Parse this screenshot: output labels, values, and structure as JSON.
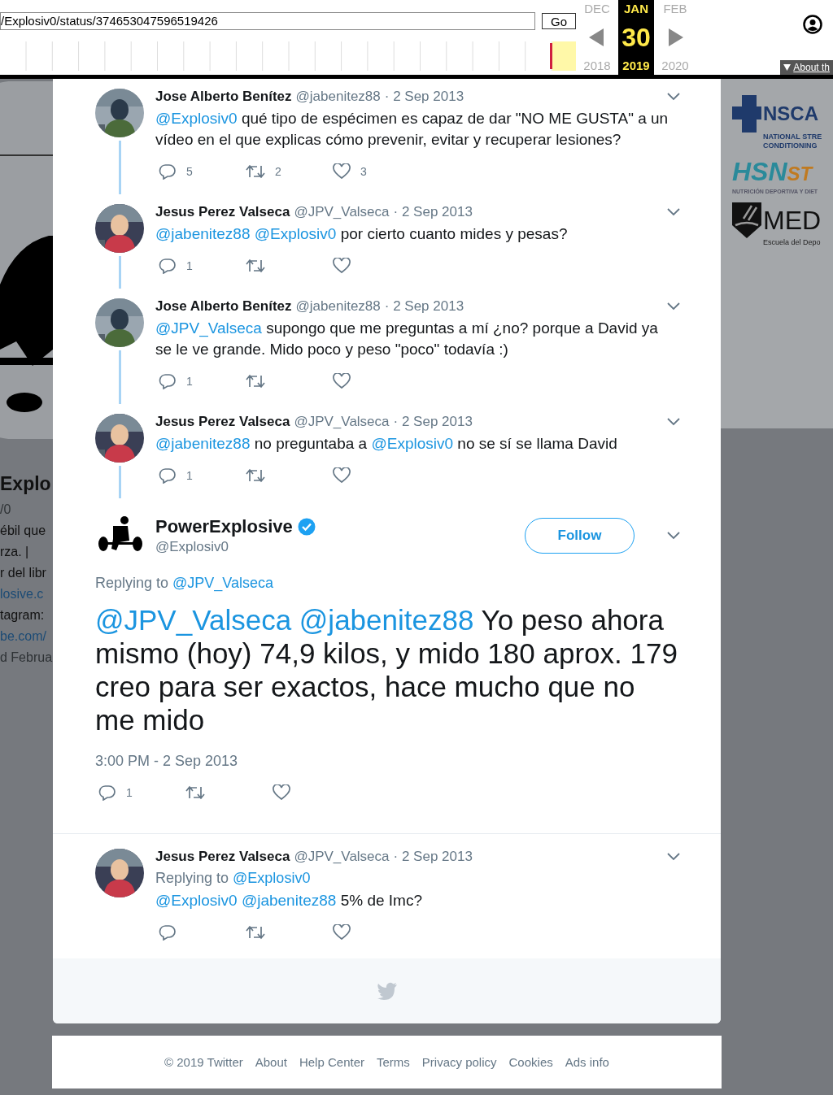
{
  "toolbar": {
    "url": "/Explosiv0/status/374653047596519426",
    "go": "Go",
    "months": [
      {
        "label": "DEC",
        "selected": false
      },
      {
        "label": "JAN",
        "selected": true
      },
      {
        "label": "FEB",
        "selected": false
      }
    ],
    "day": "30",
    "years": [
      "2018",
      "2019",
      "2020"
    ],
    "about": "About th"
  },
  "profile_fragments": [
    {
      "text": "Explo",
      "kind": "name"
    },
    {
      "text": "/0",
      "kind": "muted"
    },
    {
      "text": "ébil que",
      "kind": "text"
    },
    {
      "text": "rza. |",
      "kind": "text"
    },
    {
      "text": "r del libr",
      "kind": "text"
    },
    {
      "text": "losive.c",
      "kind": "link"
    },
    {
      "text": "tagram:",
      "kind": "text"
    },
    {
      "text": "be.com/",
      "kind": "link"
    },
    {
      "text": "d Februa",
      "kind": "muted"
    }
  ],
  "sponsor_logos": [
    {
      "kind": "nsca",
      "title": "NSCA",
      "lines": [
        "NATIONAL STRE",
        "CONDITIONING"
      ]
    },
    {
      "kind": "hsn",
      "title": "HSN",
      "accent": "ST",
      "lines": [
        "NUTRICIÓN DEPORTIVA Y DIET"
      ]
    },
    {
      "kind": "med",
      "title": "MED",
      "lines": [
        "Escuela del Depo"
      ]
    }
  ],
  "conversation": [
    {
      "author": "Jose Alberto Benítez",
      "handle": "@jabenitez88",
      "date": "· 2 Sep 2013",
      "text": [
        {
          "kind": "mention",
          "text": "@Explosiv0"
        },
        {
          "kind": "text",
          "text": " qué tipo de espécimen es capaz de dar \"NO ME GUSTA\" a un vídeo en el que explicas cómo prevenir, evitar y recuperar lesiones?"
        }
      ],
      "replies": "5",
      "retweets": "2",
      "likes": "3"
    },
    {
      "author": "Jesus Perez Valseca",
      "handle": "@JPV_Valseca",
      "date": "· 2 Sep 2013",
      "text": [
        {
          "kind": "mention",
          "text": "@jabenitez88 "
        },
        {
          "kind": "mention",
          "text": "@Explosiv0"
        },
        {
          "kind": "text",
          "text": "  por cierto cuanto mides  y pesas?"
        }
      ],
      "replies": "1"
    },
    {
      "author": "Jose Alberto Benítez",
      "handle": "@jabenitez88",
      "date": "· 2 Sep 2013",
      "text": [
        {
          "kind": "mention",
          "text": "@JPV_Valseca"
        },
        {
          "kind": "text",
          "text": " supongo que me preguntas a mí ¿no? porque a David ya se le ve grande. Mido poco y peso \"poco\" todavía :)"
        }
      ],
      "replies": "1"
    },
    {
      "author": "Jesus Perez Valseca",
      "handle": "@JPV_Valseca",
      "date": "· 2 Sep 2013",
      "text": [
        {
          "kind": "mention",
          "text": "@jabenitez88"
        },
        {
          "kind": "text",
          "text": " no preguntaba a "
        },
        {
          "kind": "mention",
          "text": "@Explosiv0"
        },
        {
          "kind": "text",
          "text": " no se sí se llama David"
        }
      ],
      "replies": "1"
    }
  ],
  "main_tweet": {
    "author": "PowerExplosive",
    "verified": true,
    "handle": "@Explosiv0",
    "follow": "Follow",
    "replying_label": "Replying to",
    "replying_to": "@JPV_Valseca",
    "text": [
      {
        "kind": "mention",
        "text": "@JPV_Valseca "
      },
      {
        "kind": "mention",
        "text": "@jabenitez88"
      },
      {
        "kind": "text",
        "text": " Yo peso ahora mismo (hoy) 74,9 kilos, y mido 180 aprox. 179 creo para ser exactos, hace mucho que no me mido"
      }
    ],
    "time": "3:00 PM - 2 Sep 2013",
    "replies": "1"
  },
  "reply": {
    "author": "Jesus Perez Valseca",
    "handle": "@JPV_Valseca",
    "date": "· 2 Sep 2013",
    "replying_label": "Replying to",
    "replying_to": "@Explosiv0",
    "text": [
      {
        "kind": "mention",
        "text": "@Explosiv0 "
      },
      {
        "kind": "mention",
        "text": "@jabenitez88"
      },
      {
        "kind": "text",
        "text": " 5% de Imc?"
      }
    ]
  },
  "footer": [
    "© 2019 Twitter",
    "About",
    "Help Center",
    "Terms",
    "Privacy policy",
    "Cookies",
    "Ads info"
  ]
}
